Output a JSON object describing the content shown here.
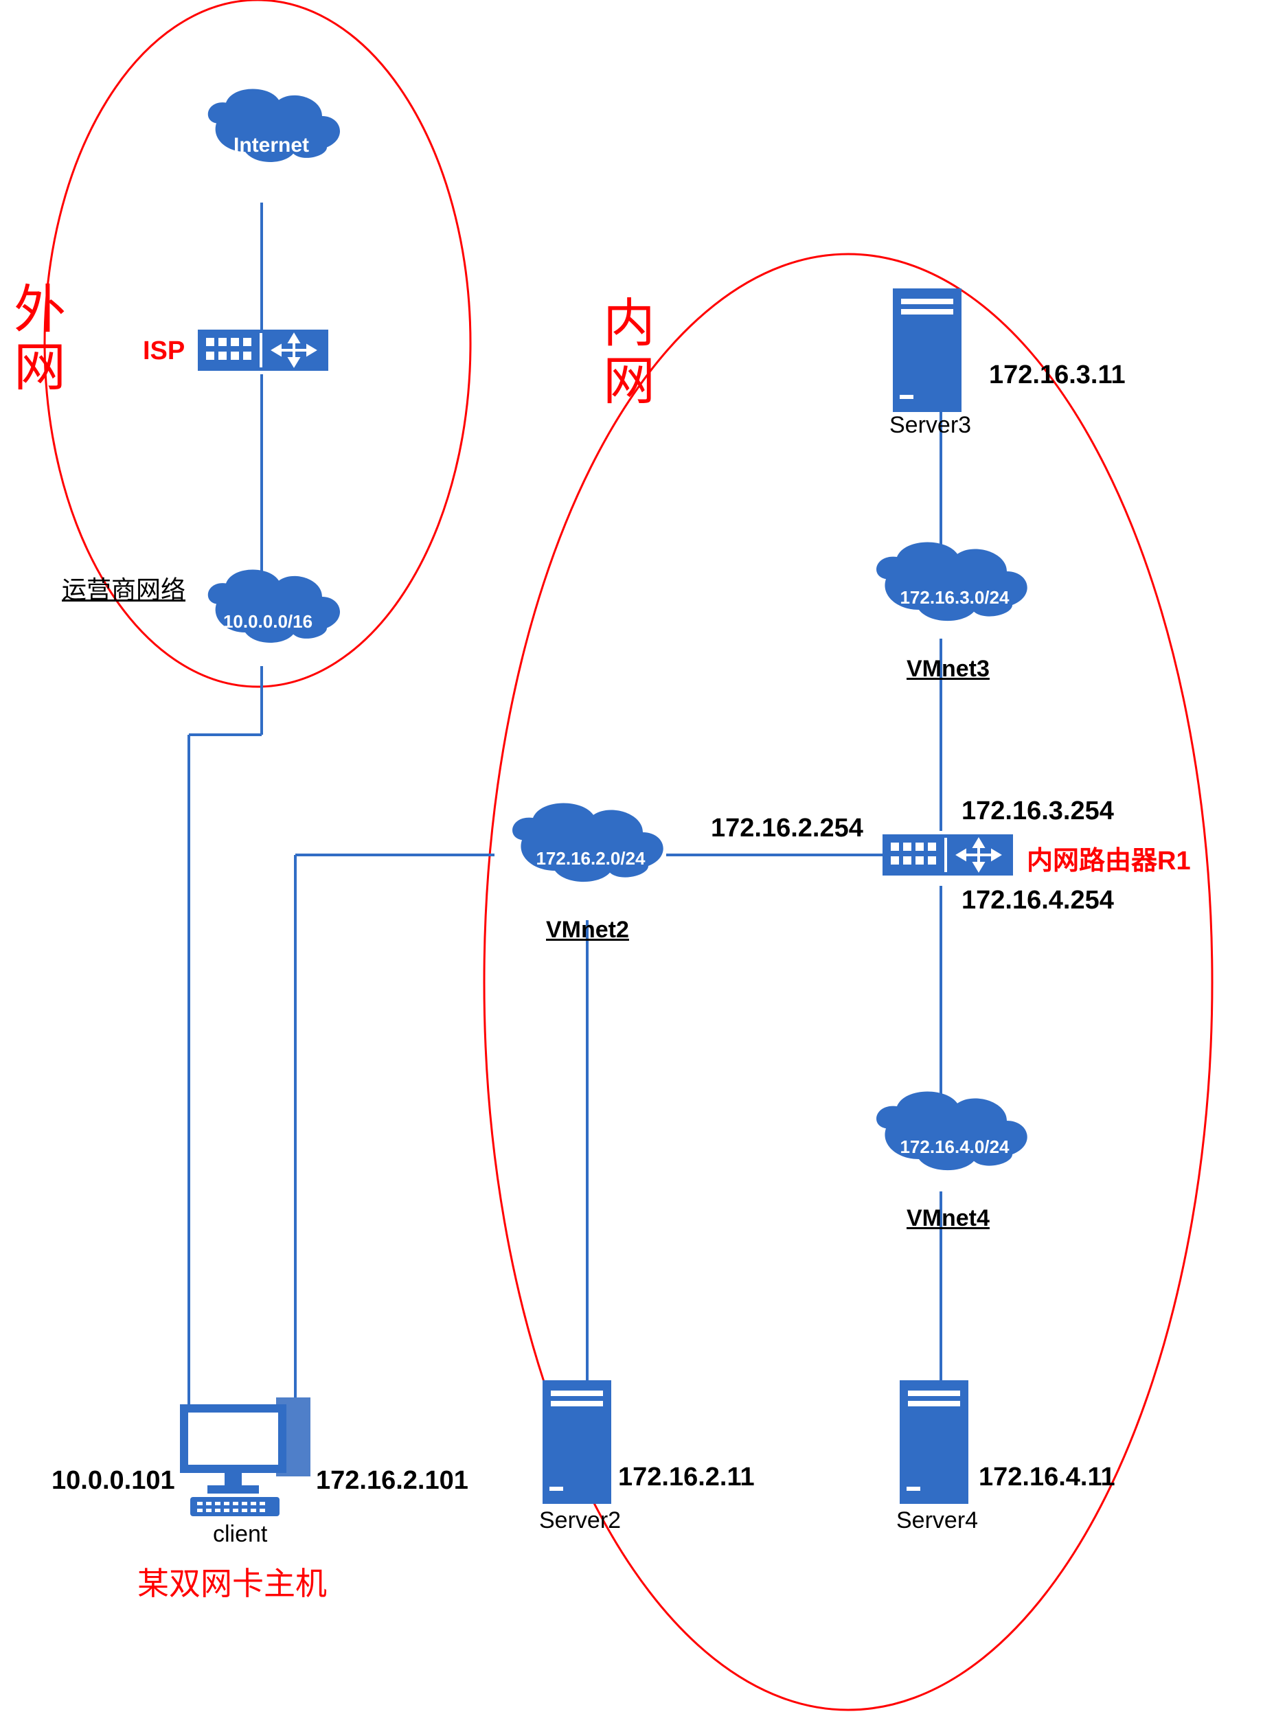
{
  "labels": {
    "wan_title": "外\n网",
    "lan_title": "内\n网",
    "internet_cloud": "Internet",
    "isp_label": "ISP",
    "carrier_network": "运营商网络",
    "carrier_cloud_ip": "10.0.0.0/16",
    "vmnet2_cloud_ip": "172.16.2.0/24",
    "vmnet2_name": "VMnet2",
    "vmnet3_cloud_ip": "172.16.3.0/24",
    "vmnet3_name": "VMnet3",
    "vmnet4_cloud_ip": "172.16.4.0/24",
    "vmnet4_name": "VMnet4",
    "server2_name": "Server2",
    "server2_ip": "172.16.2.11",
    "server3_name": "Server3",
    "server3_ip": "172.16.3.11",
    "server4_name": "Server4",
    "server4_ip": "172.16.4.11",
    "router_top_ip": "172.16.3.254",
    "router_left_ip": "172.16.2.254",
    "router_bottom_ip": "172.16.4.254",
    "router_name": "内网路由器R1",
    "client_name": "client",
    "client_left_ip": "10.0.0.101",
    "client_right_ip": "172.16.2.101",
    "client_desc": "某双网卡主机"
  },
  "colors": {
    "blue": "#316dc5",
    "blue2": "#3b6fc1",
    "red": "#ff0000",
    "black": "#000000"
  }
}
